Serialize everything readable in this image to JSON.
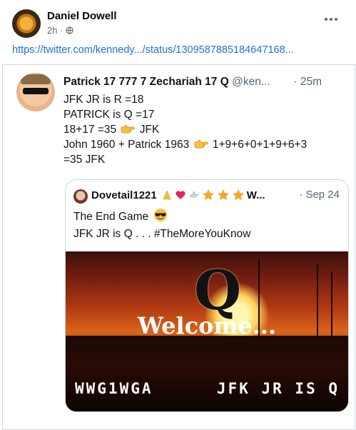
{
  "post": {
    "author": "Daniel Dowell",
    "time": "2h ·",
    "link": "https://twitter.com/kennedy.../status/1309587885184647168..."
  },
  "tweet": {
    "name": "Patrick 17 777 7 Zechariah 17 Q",
    "handle": "@ken...",
    "sep": " · ",
    "time": "25m",
    "lines": [
      "JFK JR  is     R =18",
      "PATRICK is Q =17",
      "18+17 =35",
      "JFK",
      "John 1960 + Patrick 1963",
      "1+9+6+0+1+9+6+3",
      "=35 JFK"
    ]
  },
  "quote": {
    "name": "Dovetail1221",
    "extra": "W...",
    "time": "· Sep 24",
    "line1": "The End Game",
    "line2": "JFK JR is Q . . . #TheMoreYouKnow",
    "image": {
      "big_letter": "Q",
      "welcome": "Welcome...",
      "bottom_left": "WWG1WGA",
      "bottom_right": "JFK JR IS Q"
    }
  },
  "colors": {
    "link": "#216fdb",
    "meta": "#65676b",
    "star": "#f5a623",
    "heart": "#e0245e"
  },
  "icons": {
    "globe": "globe-icon",
    "more": "more-options-icon",
    "pointing": "backhand-index-pointing-right-icon",
    "praying": "folded-hands-icon",
    "dove": "dove-icon",
    "star": "star-icon",
    "heart": "red-heart-icon",
    "sunglasses": "smiling-face-with-sunglasses-icon"
  }
}
